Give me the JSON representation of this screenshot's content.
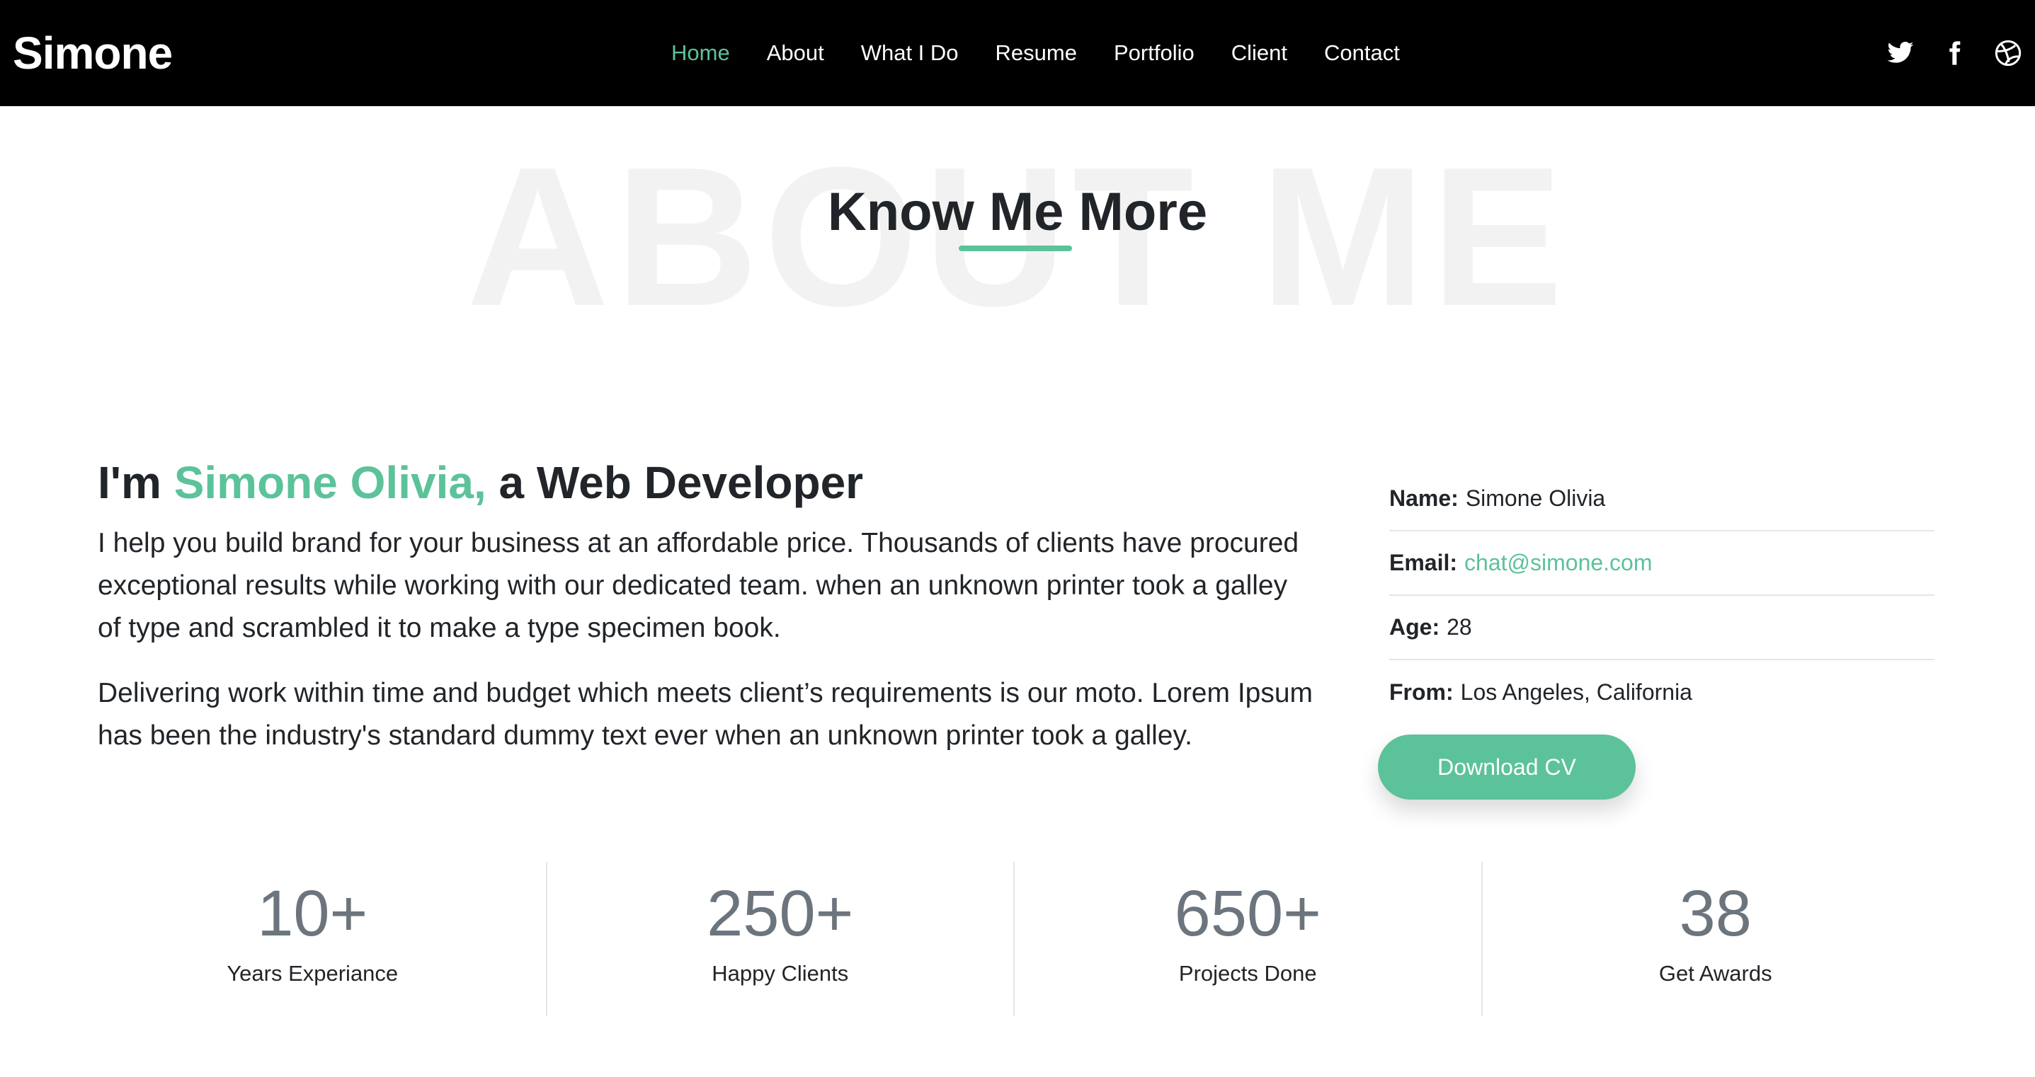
{
  "header": {
    "brand": "Simone",
    "nav": [
      {
        "label": "Home",
        "active": true
      },
      {
        "label": "About"
      },
      {
        "label": "What I Do"
      },
      {
        "label": "Resume"
      },
      {
        "label": "Portfolio"
      },
      {
        "label": "Client"
      },
      {
        "label": "Contact"
      }
    ],
    "social_icons": [
      "twitter-icon",
      "facebook-icon",
      "dribbble-icon"
    ]
  },
  "section": {
    "background_word": "ABOUT ME",
    "title": "Know Me More"
  },
  "intro": {
    "heading_prefix": "I'm ",
    "heading_name": "Simone Olivia,",
    "heading_suffix": " a Web Developer",
    "paragraph1": "I help you build brand for your business at an affordable price. Thousands of clients have procured exceptional results while working with our dedicated team. when an unknown printer took a galley of type and scrambled it to make a type specimen book.",
    "paragraph2": "Delivering work within time and budget which meets client’s requirements is our moto. Lorem Ipsum has been the industry's standard dummy text ever when an unknown printer took a galley."
  },
  "details": {
    "name_label": "Name:",
    "name_value": "Simone Olivia",
    "email_label": "Email:",
    "email_value": "chat@simone.com",
    "age_label": "Age:",
    "age_value": "28",
    "from_label": "From:",
    "from_value": "Los Angeles, California",
    "cv_button": "Download CV"
  },
  "stats": [
    {
      "value": "10+",
      "label": "Years Experiance"
    },
    {
      "value": "250+",
      "label": "Happy Clients"
    },
    {
      "value": "650+",
      "label": "Projects Done"
    },
    {
      "value": "38",
      "label": "Get Awards"
    }
  ],
  "colors": {
    "accent": "#5cc29a",
    "header_bg": "#000000",
    "text": "#212529",
    "stat_number": "#6c757d"
  }
}
